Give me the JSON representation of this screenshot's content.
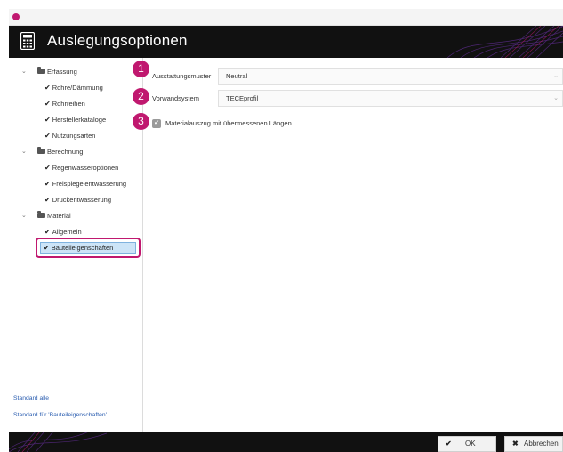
{
  "window": {
    "logo_icon": "app-logo-icon"
  },
  "header": {
    "title": "Auslegungsoptionen",
    "icon": "calculator-icon"
  },
  "tree": {
    "groups": [
      {
        "label": "Erfassung",
        "items": [
          "Rohre/Dämmung",
          "Rohrreihen",
          "Herstellerkataloge",
          "Nutzungsarten"
        ]
      },
      {
        "label": "Berechnung",
        "items": [
          "Regenwasseroptionen",
          "Freispiegelentwässerung",
          "Druckentwässerung"
        ]
      },
      {
        "label": "Material",
        "items": [
          "Allgemein",
          "Bauteileigenschaften"
        ]
      }
    ],
    "selected": "Bauteileigenschaften"
  },
  "links": {
    "standard_all": "Standard alle",
    "standard_for": "Standard für 'Bauteileigenschaften'"
  },
  "form": {
    "steps": [
      "1",
      "2",
      "3"
    ],
    "fields": [
      {
        "label": "Ausstattungsmuster",
        "value": "Neutral"
      },
      {
        "label": "Vorwandsystem",
        "value": "TECEprofil"
      }
    ],
    "checkbox": {
      "label": "Materialauszug mit übermessenen Längen",
      "checked": true
    }
  },
  "buttons": {
    "ok": "OK",
    "cancel": "Abbrechen"
  },
  "colors": {
    "accent": "#c0186f",
    "header_bg": "#111111",
    "selection": "#cce4f7"
  }
}
